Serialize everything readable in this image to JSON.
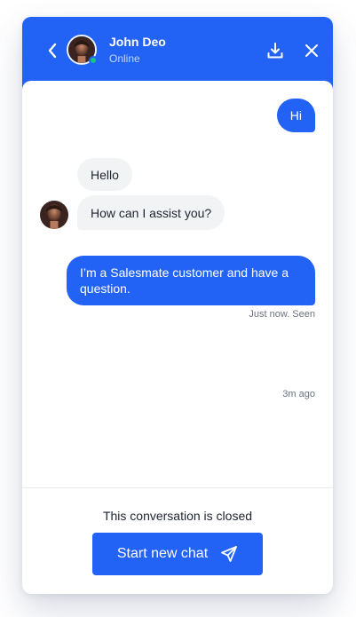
{
  "header": {
    "agent_name": "John Deo",
    "status": "Online",
    "icons": {
      "back": "chevron-left-icon",
      "download": "download-icon",
      "close": "close-icon"
    }
  },
  "messages": [
    {
      "from": "visitor",
      "text": "Hi"
    },
    {
      "from": "agent",
      "text": "Hello"
    },
    {
      "from": "agent",
      "text": "How can I assist you?"
    },
    {
      "from": "visitor",
      "text": "I’m a Salesmate customer and have a question."
    }
  ],
  "meta": {
    "seen": "Just now. Seen",
    "time_ago": "3m ago"
  },
  "footer": {
    "closed_text": "This conversation is closed",
    "start_button_label": "Start new chat",
    "start_button_icon": "send-icon"
  },
  "colors": {
    "accent": "#2263f5",
    "incoming_bubble": "#f2f3f5",
    "online": "#19c37d"
  }
}
